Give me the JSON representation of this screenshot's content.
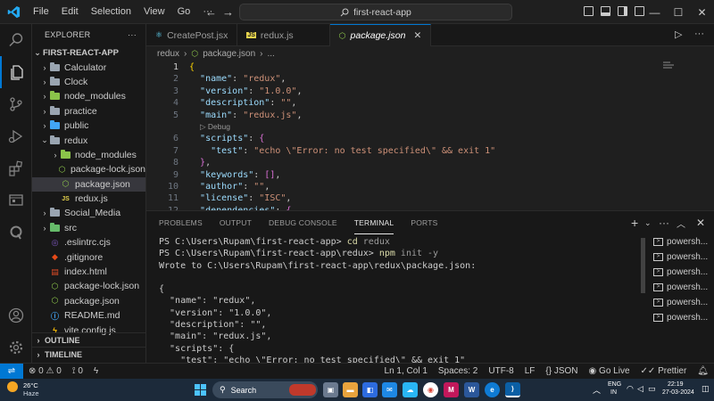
{
  "titlebar": {
    "menu": [
      "File",
      "Edit",
      "Selection",
      "View",
      "Go",
      "···"
    ],
    "search_text": "first-react-app",
    "nav_back": "←",
    "nav_forward": "→"
  },
  "sidebar": {
    "title": "EXPLORER",
    "more": "···",
    "project": "FIRST-REACT-APP",
    "items": [
      {
        "label": "Calculator",
        "type": "folder",
        "depth": 1,
        "expanded": false
      },
      {
        "label": "Clock",
        "type": "folder",
        "depth": 1,
        "expanded": false
      },
      {
        "label": "node_modules",
        "type": "folder-node",
        "depth": 1,
        "expanded": false
      },
      {
        "label": "practice",
        "type": "folder",
        "depth": 1,
        "expanded": false
      },
      {
        "label": "public",
        "type": "folder-blue",
        "depth": 1,
        "expanded": false
      },
      {
        "label": "redux",
        "type": "folder",
        "depth": 1,
        "expanded": true
      },
      {
        "label": "node_modules",
        "type": "folder-node",
        "depth": 2,
        "expanded": false
      },
      {
        "label": "package-lock.json",
        "type": "json-node",
        "depth": 2
      },
      {
        "label": "package.json",
        "type": "json-node",
        "depth": 2,
        "selected": true
      },
      {
        "label": "redux.js",
        "type": "js",
        "depth": 2
      },
      {
        "label": "Social_Media",
        "type": "folder",
        "depth": 1,
        "expanded": false
      },
      {
        "label": "src",
        "type": "folder-green",
        "depth": 1,
        "expanded": false
      },
      {
        "label": ".eslintrc.cjs",
        "type": "eslint",
        "depth": 1
      },
      {
        "label": ".gitignore",
        "type": "git",
        "depth": 1
      },
      {
        "label": "index.html",
        "type": "html",
        "depth": 1
      },
      {
        "label": "package-lock.json",
        "type": "json-node",
        "depth": 1
      },
      {
        "label": "package.json",
        "type": "json-node",
        "depth": 1
      },
      {
        "label": "README.md",
        "type": "md",
        "depth": 1
      },
      {
        "label": "vite.config.js",
        "type": "vite",
        "depth": 1
      }
    ],
    "outline": "OUTLINE",
    "timeline": "TIMELINE"
  },
  "tabs": [
    {
      "label": "CreatePost.jsx",
      "icon": "react-icon",
      "active": false
    },
    {
      "label": "redux.js",
      "icon": "js-icon",
      "active": false
    },
    {
      "label": "package.json",
      "icon": "node-icon",
      "active": true
    }
  ],
  "breadcrumb": [
    "redux",
    "package.json",
    "..."
  ],
  "editor": {
    "debug_lens": "Debug",
    "lines": [
      {
        "n": "1",
        "tokens": [
          [
            "b1",
            "{"
          ]
        ]
      },
      {
        "n": "2",
        "tokens": [
          [
            "p",
            "  "
          ],
          [
            "k",
            "\"name\""
          ],
          [
            "p",
            ": "
          ],
          [
            "s",
            "\"redux\""
          ],
          [
            "p",
            ","
          ]
        ]
      },
      {
        "n": "3",
        "tokens": [
          [
            "p",
            "  "
          ],
          [
            "k",
            "\"version\""
          ],
          [
            "p",
            ": "
          ],
          [
            "s",
            "\"1.0.0\""
          ],
          [
            "p",
            ","
          ]
        ]
      },
      {
        "n": "4",
        "tokens": [
          [
            "p",
            "  "
          ],
          [
            "k",
            "\"description\""
          ],
          [
            "p",
            ": "
          ],
          [
            "s",
            "\"\""
          ],
          [
            "p",
            ","
          ]
        ]
      },
      {
        "n": "5",
        "tokens": [
          [
            "p",
            "  "
          ],
          [
            "k",
            "\"main\""
          ],
          [
            "p",
            ": "
          ],
          [
            "s",
            "\"redux.js\""
          ],
          [
            "p",
            ","
          ]
        ]
      },
      {
        "n": "",
        "lens": true
      },
      {
        "n": "6",
        "tokens": [
          [
            "p",
            "  "
          ],
          [
            "k",
            "\"scripts\""
          ],
          [
            "p",
            ": "
          ],
          [
            "b2",
            "{"
          ]
        ]
      },
      {
        "n": "7",
        "tokens": [
          [
            "p",
            "    "
          ],
          [
            "k",
            "\"test\""
          ],
          [
            "p",
            ": "
          ],
          [
            "s",
            "\"echo \\\"Error: no test specified\\\" && exit 1\""
          ]
        ]
      },
      {
        "n": "8",
        "tokens": [
          [
            "p",
            "  "
          ],
          [
            "b2",
            "}"
          ],
          [
            "p",
            ","
          ]
        ]
      },
      {
        "n": "9",
        "tokens": [
          [
            "p",
            "  "
          ],
          [
            "k",
            "\"keywords\""
          ],
          [
            "p",
            ": "
          ],
          [
            "b2",
            "[]"
          ],
          [
            "p",
            ","
          ]
        ]
      },
      {
        "n": "10",
        "tokens": [
          [
            "p",
            "  "
          ],
          [
            "k",
            "\"author\""
          ],
          [
            "p",
            ": "
          ],
          [
            "s",
            "\"\""
          ],
          [
            "p",
            ","
          ]
        ]
      },
      {
        "n": "11",
        "tokens": [
          [
            "p",
            "  "
          ],
          [
            "k",
            "\"license\""
          ],
          [
            "p",
            ": "
          ],
          [
            "s",
            "\"ISC\""
          ],
          [
            "p",
            ","
          ]
        ]
      },
      {
        "n": "12",
        "tokens": [
          [
            "p",
            "  "
          ],
          [
            "k",
            "\"dependencies\""
          ],
          [
            "p",
            ": "
          ],
          [
            "b2",
            "{"
          ]
        ]
      }
    ]
  },
  "panel": {
    "tabs": [
      "PROBLEMS",
      "OUTPUT",
      "DEBUG CONSOLE",
      "TERMINAL",
      "PORTS"
    ],
    "active_tab": "TERMINAL",
    "terminal_lines": [
      {
        "prompt": "PS C:\\Users\\Rupam\\first-react-app> ",
        "cmd": "cd",
        "arg": " redux"
      },
      {
        "prompt": "PS C:\\Users\\Rupam\\first-react-app\\redux> ",
        "cmd": "npm",
        "arg": " init -y"
      },
      {
        "text": "Wrote to C:\\Users\\Rupam\\first-react-app\\redux\\package.json:"
      },
      {
        "text": ""
      },
      {
        "text": "{"
      },
      {
        "text": "  \"name\": \"redux\","
      },
      {
        "text": "  \"version\": \"1.0.0\","
      },
      {
        "text": "  \"description\": \"\","
      },
      {
        "text": "  \"main\": \"redux.js\","
      },
      {
        "text": "  \"scripts\": {"
      },
      {
        "text": "    \"test\": \"echo \\\"Error: no test specified\\\" && exit 1\""
      }
    ],
    "terminals": [
      "powersh...",
      "powersh...",
      "powersh...",
      "powersh...",
      "powersh...",
      "powersh..."
    ]
  },
  "statusbar": {
    "remote": "⇌",
    "errors": "0",
    "warnings": "0",
    "ports": "0",
    "position": "Ln 1, Col 1",
    "spaces": "Spaces: 2",
    "encoding": "UTF-8",
    "eol": "LF",
    "language": "{} JSON",
    "golive": "Go Live",
    "prettier": "Prettier"
  },
  "taskbar": {
    "temp": "26°C",
    "weather": "Haze",
    "search": "Search",
    "lang_top": "ENG",
    "lang_bottom": "IN",
    "time": "22:19",
    "date": "27-03-2024"
  },
  "colors": {
    "accent": "#0078d4",
    "string": "#ce9178",
    "key": "#9cdcfe",
    "json_icon": "#8bc34a"
  }
}
